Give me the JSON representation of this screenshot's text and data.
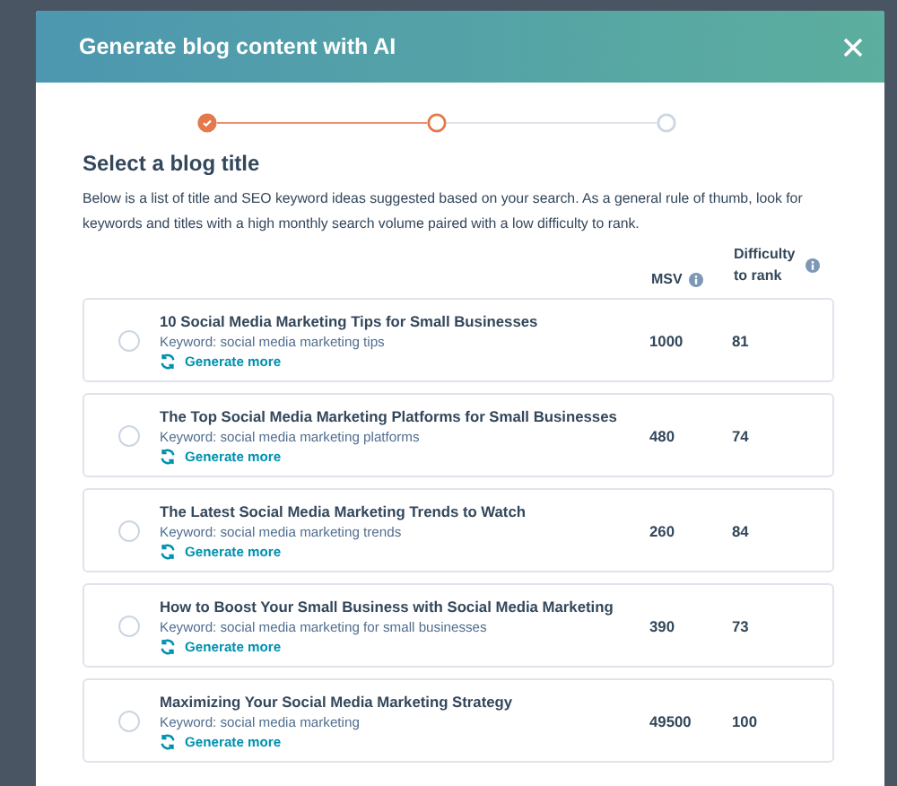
{
  "dialog": {
    "title": "Generate blog content with AI"
  },
  "steps": [
    {
      "complete": true,
      "current": false
    },
    {
      "complete": false,
      "current": true
    },
    {
      "complete": false,
      "current": false
    }
  ],
  "section": {
    "heading": "Select a blog title",
    "description": "Below is a list of title and SEO keyword ideas suggested based on your search. As a general rule of thumb, look for keywords and titles with a high monthly search volume paired with a low difficulty to rank."
  },
  "columns": [
    {
      "label": "MSV"
    },
    {
      "label": "Difficulty to rank"
    }
  ],
  "titles": [
    {
      "title": "10 Social Media Marketing Tips for Small Businesses",
      "keyword": "Keyword: social media marketing tips",
      "action": "Generate more",
      "msv": "1000",
      "difficulty": "81",
      "selected": false
    },
    {
      "title": "The Top Social Media Marketing Platforms for Small Businesses",
      "keyword": "Keyword: social media marketing platforms",
      "action": "Generate more",
      "msv": "480",
      "difficulty": "74",
      "selected": false
    },
    {
      "title": "The Latest Social Media Marketing Trends to Watch",
      "keyword": "Keyword: social media marketing trends",
      "action": "Generate more",
      "msv": "260",
      "difficulty": "84",
      "selected": false
    },
    {
      "title": "How to Boost Your Small Business with Social Media Marketing",
      "keyword": "Keyword: social media marketing for small businesses",
      "action": "Generate more",
      "msv": "390",
      "difficulty": "73",
      "selected": false
    },
    {
      "title": "Maximizing Your Social Media Marketing Strategy",
      "keyword": "Keyword: social media marketing",
      "action": "Generate more",
      "msv": "49500",
      "difficulty": "100",
      "selected": false
    }
  ]
}
